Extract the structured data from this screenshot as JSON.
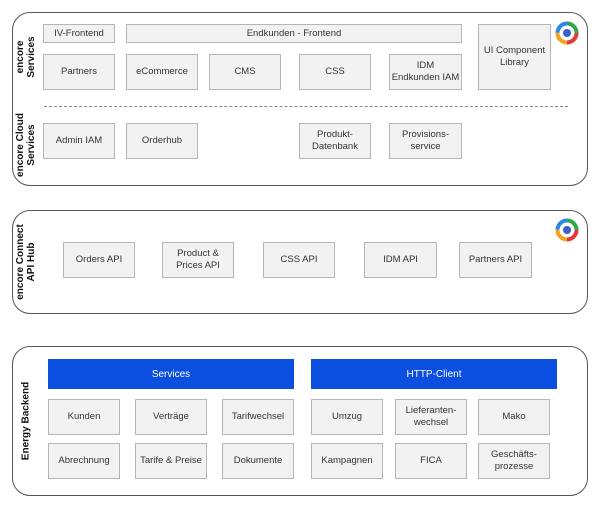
{
  "top": {
    "services_label": "encore\nServices",
    "cloud_label": "encore Cloud\nServices",
    "boxes": {
      "iv_frontend": "IV-Frontend",
      "endkunden_frontend": "Endkunden - Frontend",
      "partners": "Partners",
      "ecommerce": "eCommerce",
      "cms": "CMS",
      "css": "CSS",
      "idm": "IDM\nEndkunden IAM",
      "ui_library": "UI Component\nLibrary",
      "admin_iam": "Admin IAM",
      "orderhub": "Orderhub",
      "produkt_datenbank": "Produkt-\nDatenbank",
      "provisionsservice": "Provisions-\nservice"
    }
  },
  "connect": {
    "label": "encore Connect\nAPI Hub",
    "apis": [
      "Orders API",
      "Product &\nPrices API",
      "CSS API",
      "IDM API",
      "Partners API"
    ]
  },
  "backend": {
    "label": "Energy Backend",
    "services_header": "Services",
    "http_header": "HTTP-Client",
    "services_items": [
      "Kunden",
      "Verträge",
      "Tarifwechsel",
      "Abrechnung",
      "Tarife & Preise",
      "Dokumente"
    ],
    "http_items": [
      "Umzug",
      "Lieferanten-\nwechsel",
      "Mako",
      "Kampagnen",
      "FICA",
      "Geschäfts-\nprozesse"
    ]
  },
  "colors": {
    "accent_blue": "#0a4fe0",
    "box_fill": "#f2f2f2",
    "panel_border": "#555555"
  },
  "icons": [
    "encore-logo-icon"
  ]
}
